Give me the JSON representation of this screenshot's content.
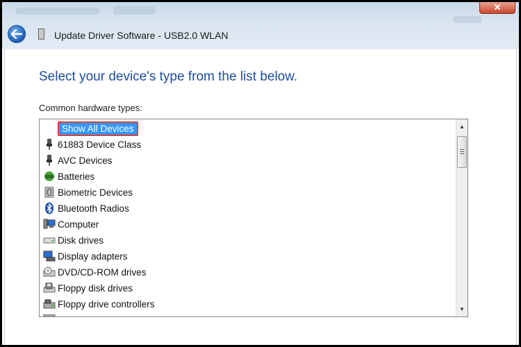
{
  "window": {
    "title": "Update Driver Software - USB2.0 WLAN",
    "close_label": "✕"
  },
  "main": {
    "heading": "Select your device's type from the list below.",
    "list_label": "Common hardware types:"
  },
  "hardware_list": {
    "items": [
      {
        "label": "Show All Devices",
        "icon": "none",
        "selected": true
      },
      {
        "label": "61883 Device Class",
        "icon": "connector-icon"
      },
      {
        "label": "AVC Devices",
        "icon": "connector-icon"
      },
      {
        "label": "Batteries",
        "icon": "battery-icon"
      },
      {
        "label": "Biometric Devices",
        "icon": "fingerprint-icon"
      },
      {
        "label": "Bluetooth Radios",
        "icon": "bluetooth-icon"
      },
      {
        "label": "Computer",
        "icon": "computer-icon"
      },
      {
        "label": "Disk drives",
        "icon": "disk-drive-icon"
      },
      {
        "label": "Display adapters",
        "icon": "display-adapter-icon"
      },
      {
        "label": "DVD/CD-ROM drives",
        "icon": "dvd-drive-icon"
      },
      {
        "label": "Floppy disk drives",
        "icon": "floppy-drive-icon"
      },
      {
        "label": "Floppy drive controllers",
        "icon": "floppy-controller-icon"
      }
    ]
  },
  "colors": {
    "selection": "#3399ff",
    "highlight_border": "#e03c31",
    "heading": "#1d4d9c"
  }
}
